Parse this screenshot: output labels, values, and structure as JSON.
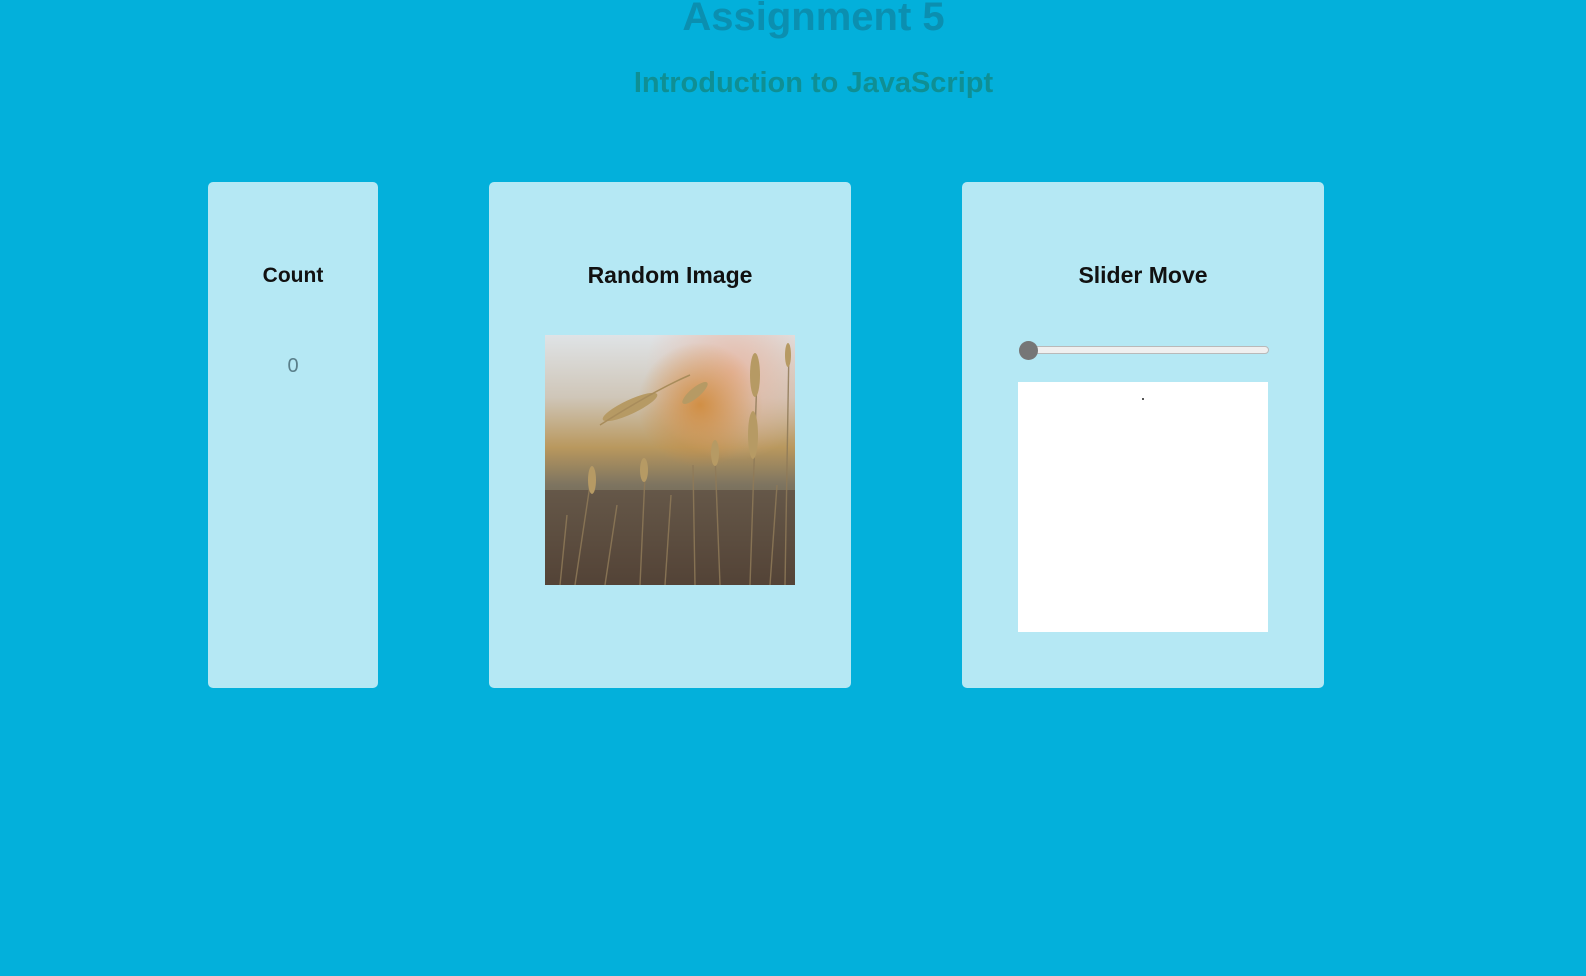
{
  "header": {
    "title": "Assignment 5",
    "subtitle": "Introduction to JavaScript"
  },
  "count_card": {
    "heading": "Count",
    "value": "0"
  },
  "image_card": {
    "heading": "Random Image",
    "image_alt": "photo of wheat stalks in a field"
  },
  "slider_card": {
    "heading": "Slider Move",
    "slider_value_fraction": 0.0
  },
  "colors": {
    "background": "#03b0db",
    "card": "#b5e8f4",
    "title": "#0b8fb0",
    "subtitle": "#0f8f94",
    "slider_thumb": "#767676"
  }
}
